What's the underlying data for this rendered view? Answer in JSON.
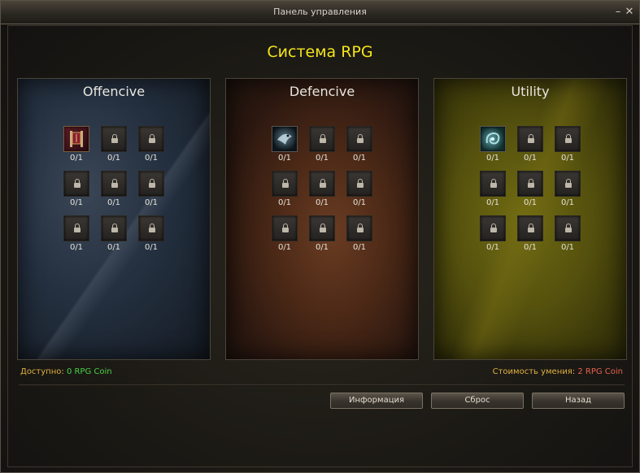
{
  "window": {
    "title": "Панель управления",
    "minimize_icon": "minimize-icon",
    "close_icon": "close-icon",
    "close_glyph": "✕",
    "minimize_glyph": "–"
  },
  "heading": "Система RPG",
  "panels": [
    {
      "title": "Offencive",
      "color": "#2a3644",
      "skills": [
        {
          "count": "0/1",
          "unlocked": true,
          "icon": "flag-banner-icon"
        },
        {
          "count": "0/1",
          "unlocked": false
        },
        {
          "count": "0/1",
          "unlocked": false
        },
        {
          "count": "0/1",
          "unlocked": false
        },
        {
          "count": "0/1",
          "unlocked": false
        },
        {
          "count": "0/1",
          "unlocked": false
        },
        {
          "count": "0/1",
          "unlocked": false
        },
        {
          "count": "0/1",
          "unlocked": false
        },
        {
          "count": "0/1",
          "unlocked": false
        }
      ]
    },
    {
      "title": "Defencive",
      "color": "#4a2816",
      "skills": [
        {
          "count": "0/1",
          "unlocked": true,
          "icon": "shield-bird-icon"
        },
        {
          "count": "0/1",
          "unlocked": false
        },
        {
          "count": "0/1",
          "unlocked": false
        },
        {
          "count": "0/1",
          "unlocked": false
        },
        {
          "count": "0/1",
          "unlocked": false
        },
        {
          "count": "0/1",
          "unlocked": false
        },
        {
          "count": "0/1",
          "unlocked": false
        },
        {
          "count": "0/1",
          "unlocked": false
        },
        {
          "count": "0/1",
          "unlocked": false
        }
      ]
    },
    {
      "title": "Utility",
      "color": "#56520e",
      "skills": [
        {
          "count": "0/1",
          "unlocked": true,
          "icon": "swirl-icon"
        },
        {
          "count": "0/1",
          "unlocked": false
        },
        {
          "count": "0/1",
          "unlocked": false
        },
        {
          "count": "0/1",
          "unlocked": false
        },
        {
          "count": "0/1",
          "unlocked": false
        },
        {
          "count": "0/1",
          "unlocked": false
        },
        {
          "count": "0/1",
          "unlocked": false
        },
        {
          "count": "0/1",
          "unlocked": false
        },
        {
          "count": "0/1",
          "unlocked": false
        }
      ]
    }
  ],
  "footer": {
    "available_label": "Доступно:",
    "available_value": "0 RPG Coin",
    "cost_label": "Стоимость умения:",
    "cost_value": "2 RPG Coin"
  },
  "buttons": {
    "info": "Информация",
    "reset": "Сброс",
    "back": "Назад"
  },
  "colors": {
    "heading": "#f4e51a",
    "available_value": "#46d246",
    "cost_value": "#e86050",
    "label": "#e0b040"
  }
}
